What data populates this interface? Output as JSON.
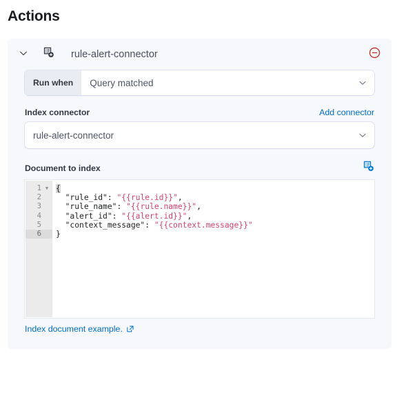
{
  "page": {
    "title": "Actions"
  },
  "action_panel": {
    "collapse_icon": "chevron-down-icon",
    "type_icon": "index-document-icon",
    "connector_name": "rule-alert-connector",
    "remove_icon": "circle-minus-icon",
    "run_when": {
      "prepend_label": "Run when",
      "selected": "Query matched",
      "caret_icon": "chevron-down-icon"
    },
    "index_connector": {
      "label": "Index connector",
      "add_link": "Add connector",
      "selected": "rule-alert-connector",
      "caret_icon": "chevron-down-icon"
    },
    "document_to_index": {
      "label": "Document to index",
      "header_icon": "index-document-icon",
      "editor": {
        "line_numbers": [
          "1",
          "2",
          "3",
          "4",
          "5",
          "6"
        ],
        "active_line": 6,
        "fold_lines": [
          1
        ],
        "lines": [
          [
            {
              "t": "punct",
              "v": "{",
              "cursor": true
            }
          ],
          [
            {
              "t": "punct",
              "v": "  "
            },
            {
              "t": "key",
              "v": "\"rule_id\""
            },
            {
              "t": "punct",
              "v": ": "
            },
            {
              "t": "str",
              "v": "\"{{rule.id}}\""
            },
            {
              "t": "punct",
              "v": ","
            }
          ],
          [
            {
              "t": "punct",
              "v": "  "
            },
            {
              "t": "key",
              "v": "\"rule_name\""
            },
            {
              "t": "punct",
              "v": ": "
            },
            {
              "t": "str",
              "v": "\"{{rule.name}}\""
            },
            {
              "t": "punct",
              "v": ","
            }
          ],
          [
            {
              "t": "punct",
              "v": "  "
            },
            {
              "t": "key",
              "v": "\"alert_id\""
            },
            {
              "t": "punct",
              "v": ": "
            },
            {
              "t": "str",
              "v": "\"{{alert.id}}\""
            },
            {
              "t": "punct",
              "v": ","
            }
          ],
          [
            {
              "t": "punct",
              "v": "  "
            },
            {
              "t": "key",
              "v": "\"context_message\""
            },
            {
              "t": "punct",
              "v": ": "
            },
            {
              "t": "str",
              "v": "\"{{context.message}}\""
            }
          ],
          [
            {
              "t": "punct",
              "v": "}"
            }
          ]
        ]
      },
      "footer_link": "Index document example.",
      "footer_link_icon": "external-link-icon"
    }
  },
  "colors": {
    "panel_bg": "#f7f8fc",
    "link": "#006bb8",
    "danger": "#bd271e",
    "icon_dark": "#343741",
    "icon_blue": "#0077cc",
    "code_string": "#d1436c"
  }
}
